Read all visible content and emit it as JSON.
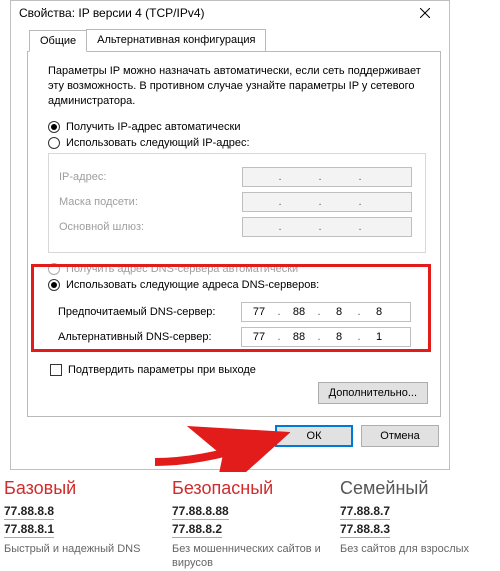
{
  "window": {
    "title": "Свойства: IP версии 4 (TCP/IPv4)"
  },
  "tabs": {
    "general": "Общие",
    "alt": "Альтернативная конфигурация"
  },
  "desc": "Параметры IP можно назначать автоматически, если сеть поддерживает эту возможность. В противном случае узнайте параметры IP у сетевого администратора.",
  "ip": {
    "auto": "Получить IP-адрес автоматически",
    "manual": "Использовать следующий IP-адрес:",
    "addr_label": "IP-адрес:",
    "mask_label": "Маска подсети:",
    "gw_label": "Основной шлюз:"
  },
  "dns": {
    "auto": "Получить адрес DNS-сервера автоматически",
    "manual": "Использовать следующие адреса DNS-серверов:",
    "pref_label": "Предпочитаемый DNS-сервер:",
    "alt_label": "Альтернативный DNS-сервер:",
    "pref": {
      "o1": "77",
      "o2": "88",
      "o3": "8",
      "o4": "8"
    },
    "altv": {
      "o1": "77",
      "o2": "88",
      "o3": "8",
      "o4": "1"
    }
  },
  "confirm_exit": "Подтвердить параметры при выходе",
  "advanced": "Дополнительно...",
  "ok": "ОК",
  "cancel": "Отмена",
  "profiles": {
    "basic": {
      "title": "Базовый",
      "ip1": "77.88.8.8",
      "ip2": "77.88.8.1",
      "cap": "Быстрый и надежный DNS"
    },
    "safe": {
      "title": "Безопасный",
      "ip1": "77.88.8.88",
      "ip2": "77.88.8.2",
      "cap": "Без мошеннических сайтов и вирусов"
    },
    "family": {
      "title": "Семейный",
      "ip1": "77.88.8.7",
      "ip2": "77.88.8.3",
      "cap": "Без сайтов для взрослых"
    }
  }
}
